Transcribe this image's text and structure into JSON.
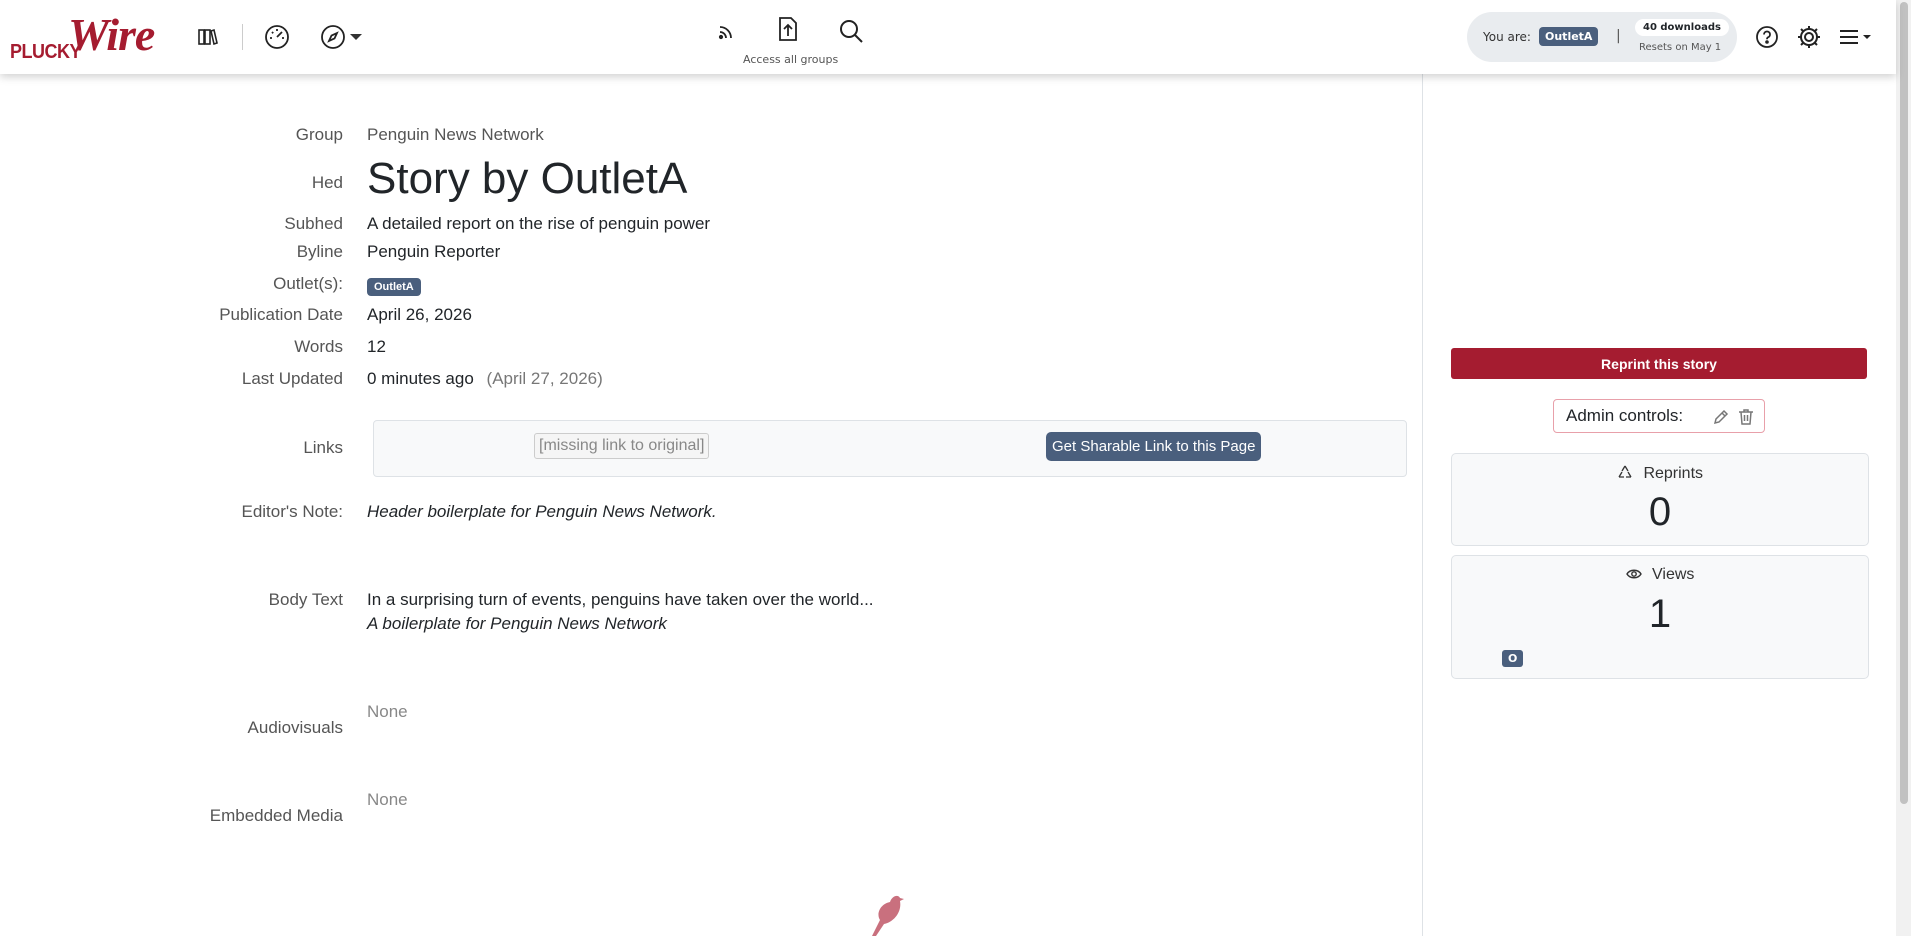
{
  "brand": {
    "small": "PLUCKY",
    "big": "Wire",
    "color": "#a51c30"
  },
  "header": {
    "center_caption": "Access all groups",
    "you_are_label": "You are:",
    "outlet_badge": "OutletA",
    "pipe": "|",
    "downloads": "40 downloads",
    "resets": "Resets on May 1"
  },
  "icons": {
    "library": "library-icon",
    "dashboard": "dashboard-icon",
    "compass": "compass-icon",
    "rss": "rss-icon",
    "upload": "upload-icon",
    "search": "search-icon",
    "help": "help-icon",
    "settings": "gear-icon",
    "menu": "menu-icon"
  },
  "story": {
    "labels": {
      "group": "Group",
      "hed": "Hed",
      "subhed": "Subhed",
      "byline": "Byline",
      "outlets": "Outlet(s):",
      "pub_date": "Publication Date",
      "words": "Words",
      "last_updated": "Last Updated",
      "links": "Links",
      "editors_note": "Editor's Note:",
      "body_text": "Body Text",
      "audiovisuals": "Audiovisuals",
      "embedded_media": "Embedded Media"
    },
    "group": "Penguin News Network",
    "hed": "Story by OutletA",
    "subhed": "A detailed report on the rise of penguin power",
    "byline": "Penguin Reporter",
    "outlet_badge": "OutletA",
    "pub_date": "April 26, 2026",
    "words": "12",
    "last_updated": "0 minutes ago",
    "last_updated_date": "(April 27, 2026)",
    "missing_link": "[missing link to original]",
    "share_button": "Get Sharable Link to this Page",
    "editors_note": "Header boilerplate for Penguin News Network.",
    "body_text": "In a surprising turn of events, penguins have taken over the world...",
    "body_boilerplate": "A boilerplate for Penguin News Network",
    "audiovisuals": "None",
    "embedded_media": "None"
  },
  "sidebar": {
    "reprint_button": "Reprint this story",
    "admin_label": "Admin controls:",
    "reprints_label": "Reprints",
    "reprints_count": "0",
    "views_label": "Views",
    "views_count": "1",
    "views_badge": "O"
  }
}
